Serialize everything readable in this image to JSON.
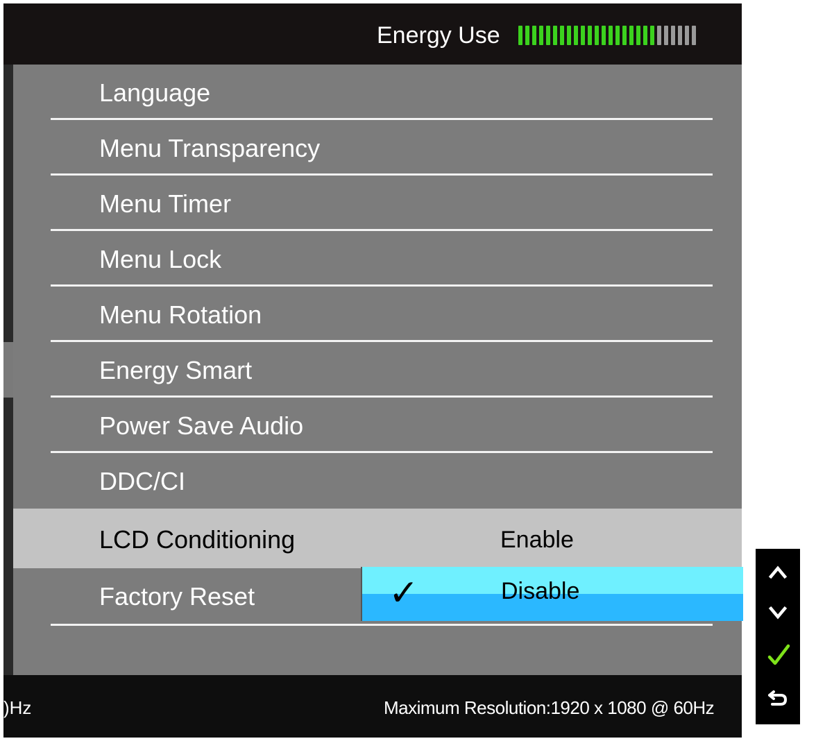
{
  "header": {
    "energy_label": "Energy Use",
    "energy_meter": {
      "level": 0.77,
      "segments": 26,
      "active_color": "#3cd21e",
      "inactive_color": "#9a9a9a"
    }
  },
  "menu": {
    "items": [
      {
        "label": "Language"
      },
      {
        "label": "Menu Transparency"
      },
      {
        "label": "Menu Timer"
      },
      {
        "label": "Menu Lock"
      },
      {
        "label": "Menu Rotation"
      },
      {
        "label": "Energy Smart"
      },
      {
        "label": "Power Save Audio"
      },
      {
        "label": "DDC/CI"
      },
      {
        "label": "LCD Conditioning",
        "selected": true
      },
      {
        "label": "Factory Reset"
      }
    ],
    "submenu": {
      "enable_label": "Enable",
      "disable_label": "Disable",
      "current": "Disable",
      "highlight_color": "#2bb8ff"
    }
  },
  "footer": {
    "left_text": ")Hz",
    "right_text": "Maximum Resolution:1920 x 1080 @ 60Hz"
  },
  "buttons": [
    {
      "icon": "chevron-up-icon"
    },
    {
      "icon": "chevron-down-icon"
    },
    {
      "icon": "checkmark-icon",
      "color": "#7ee21a"
    },
    {
      "icon": "return-icon"
    }
  ]
}
